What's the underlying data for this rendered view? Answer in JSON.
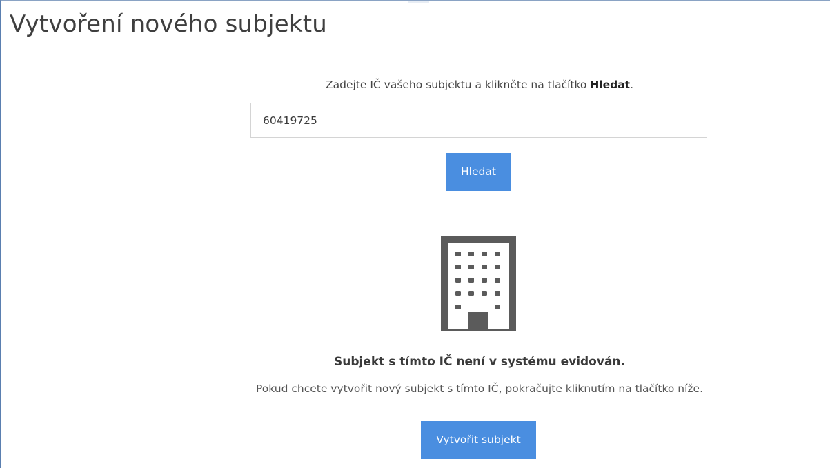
{
  "page": {
    "title": "Vytvoření nového subjektu"
  },
  "search": {
    "instruction_prefix": "Zadejte IČ vašeho subjektu a klikněte na tlačítko ",
    "instruction_bold": "Hledat",
    "instruction_suffix": ".",
    "ic_value": "60419725",
    "button_label": "Hledat"
  },
  "result": {
    "icon": "building-icon",
    "title": "Subjekt s tímto IČ není v systému evidován.",
    "description": "Pokud chcete vytvořit nový subjekt s tímto IČ, pokračujte kliknutím na tlačítko níže.",
    "create_button_label": "Vytvořit subjekt"
  },
  "colors": {
    "primary_button": "#4a8ee0",
    "icon_gray": "#5b5b5b",
    "frame_border": "#5a7fb0"
  }
}
